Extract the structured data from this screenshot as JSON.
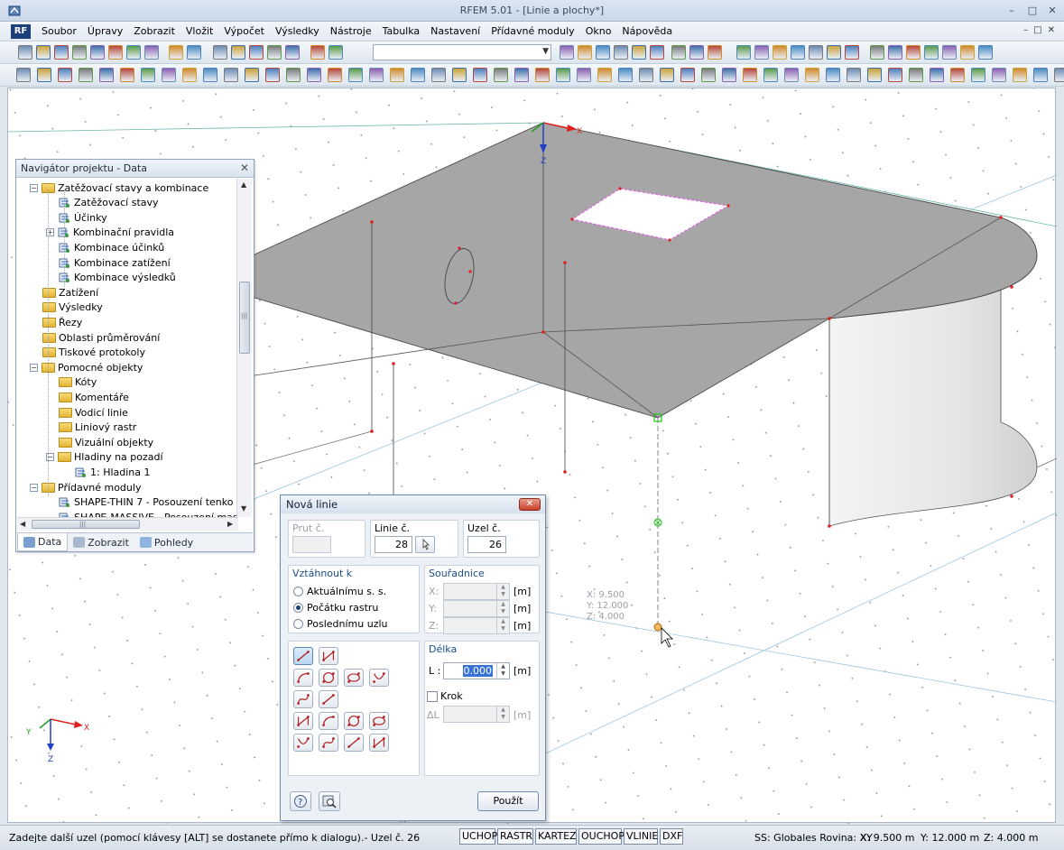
{
  "window": {
    "title": "RFEM 5.01 - [Linie a plochy*]",
    "min_glyph": "–",
    "max_glyph": "□",
    "close_glyph": "✕"
  },
  "menu": {
    "logo": "RF",
    "items": [
      "Soubor",
      "Úpravy",
      "Zobrazit",
      "Vložit",
      "Výpočet",
      "Výsledky",
      "Nástroje",
      "Tabulka",
      "Nastavení",
      "Přídavné moduly",
      "Okno",
      "Nápověda"
    ],
    "mdi": [
      "–",
      "□",
      "✕"
    ]
  },
  "navigator": {
    "title": "Navigátor projektu - Data",
    "close": "✕",
    "tree": [
      {
        "label": "Zatěžovací stavy a kombinace",
        "level": 1,
        "kind": "folder",
        "expander": "−"
      },
      {
        "label": "Zatěžovací stavy",
        "level": 2,
        "kind": "doc"
      },
      {
        "label": "Účinky",
        "level": 2,
        "kind": "doc"
      },
      {
        "label": "Kombinační pravidla",
        "level": 2,
        "kind": "doc",
        "expander": "+"
      },
      {
        "label": "Kombinace účinků",
        "level": 2,
        "kind": "doc"
      },
      {
        "label": "Kombinace zatížení",
        "level": 2,
        "kind": "doc"
      },
      {
        "label": "Kombinace výsledků",
        "level": 2,
        "kind": "doc"
      },
      {
        "label": "Zatížení",
        "level": 1,
        "kind": "folder"
      },
      {
        "label": "Výsledky",
        "level": 1,
        "kind": "folder"
      },
      {
        "label": "Řezy",
        "level": 1,
        "kind": "folder"
      },
      {
        "label": "Oblasti průměrování",
        "level": 1,
        "kind": "folder"
      },
      {
        "label": "Tiskové protokoly",
        "level": 1,
        "kind": "folder"
      },
      {
        "label": "Pomocné objekty",
        "level": 1,
        "kind": "folder",
        "expander": "−"
      },
      {
        "label": "Kóty",
        "level": 2,
        "kind": "folder"
      },
      {
        "label": "Komentáře",
        "level": 2,
        "kind": "folder"
      },
      {
        "label": "Vodicí linie",
        "level": 2,
        "kind": "folder"
      },
      {
        "label": "Liniový rastr",
        "level": 2,
        "kind": "folder"
      },
      {
        "label": "Vizuální objekty",
        "level": 2,
        "kind": "folder"
      },
      {
        "label": "Hladiny na pozadí",
        "level": 2,
        "kind": "folder",
        "expander": "−"
      },
      {
        "label": "1: Hladina 1",
        "level": 3,
        "kind": "doc"
      },
      {
        "label": "Přídavné moduly",
        "level": 1,
        "kind": "folder",
        "expander": "−"
      },
      {
        "label": "SHAPE-THIN 7 - Posouzení tenko",
        "level": 2,
        "kind": "doc"
      },
      {
        "label": "SHAPE-MASSIVE - Posouzení mas",
        "level": 2,
        "kind": "doc"
      }
    ],
    "tabs": [
      "Data",
      "Zobrazit",
      "Pohledy"
    ],
    "scroll_arrows": {
      "up": "▲",
      "down": "▼",
      "left": "◀",
      "right": "▶",
      "grip": "|||"
    }
  },
  "dialog": {
    "title": "Nová linie",
    "close": "✕",
    "prut_label": "Prut č.",
    "prut_value": "",
    "linie_label": "Linie č.",
    "linie_value": "28",
    "uzel_label": "Uzel č.",
    "uzel_value": "26",
    "vztahnout_label": "Vztáhnout k",
    "options": [
      "Aktuálnímu s. s.",
      "Počátku rastru",
      "Poslednímu uzlu"
    ],
    "selected_option": 1,
    "souradnice_label": "Souřadnice",
    "coord_labels": [
      "X:",
      "Y:",
      "Z:"
    ],
    "coord_unit": "[m]",
    "delka_label": "Délka",
    "l_label": "L :",
    "l_value": "0.000",
    "krok_label": "Krok",
    "delta_label": "ΔL :",
    "apply_label": "Použít"
  },
  "scene": {
    "axis_x": "X",
    "axis_z": "Z",
    "mini_axes": {
      "x": "X",
      "y": "Y",
      "z": "Z"
    },
    "cursor_info": [
      "X: 9.500",
      "Y: 12.000",
      "Z: 4.000"
    ]
  },
  "statusbar": {
    "message": "Zadejte další uzel (pomocí klávesy [ALT] se dostanete přímo k dialogu).- Uzel č. 26",
    "toggles": [
      "UCHOP",
      "RASTR",
      "KARTEZ",
      "OUCHOP",
      "VLINIE",
      "DXF"
    ],
    "ss": "SS: Globales Rovina: XY",
    "x": "X:  9.500 m",
    "y": "Y:  12.000 m",
    "z": "Z:  4.000 m"
  },
  "colors": {
    "accent": "#1b3f7a",
    "surface": "#a6a6a6",
    "selection": "#e060e0",
    "node": "#e02020",
    "snap": "#20c020"
  }
}
